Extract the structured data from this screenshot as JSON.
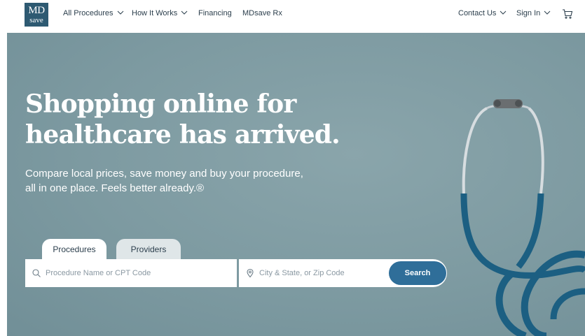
{
  "header": {
    "logo_line1": "MD",
    "logo_line2": "save",
    "nav": [
      {
        "label": "All Procedures",
        "has_dropdown": true
      },
      {
        "label": "How It Works",
        "has_dropdown": true
      },
      {
        "label": "Financing",
        "has_dropdown": false
      },
      {
        "label": "MDsave Rx",
        "has_dropdown": false
      }
    ],
    "right_nav": [
      {
        "label": "Contact Us",
        "has_dropdown": true
      },
      {
        "label": "Sign In",
        "has_dropdown": true
      }
    ],
    "cart_icon": "cart-icon"
  },
  "hero": {
    "title_line1": "Shopping online for",
    "title_line2": "healthcare has arrived.",
    "subtitle_line1": "Compare local prices, save money and buy your procedure,",
    "subtitle_line2": "all in one place. Feels better already.®"
  },
  "search": {
    "tabs": [
      {
        "label": "Procedures",
        "active": true
      },
      {
        "label": "Providers",
        "active": false
      }
    ],
    "procedure_placeholder": "Procedure Name or CPT Code",
    "procedure_value": "",
    "location_placeholder": "City & State, or Zip Code",
    "location_value": "",
    "button_label": "Search"
  },
  "colors": {
    "brand": "#2e5a72",
    "hero_bg": "#7d9aa1",
    "button": "#2f6e99",
    "stethoscope": "#1c5f82"
  }
}
